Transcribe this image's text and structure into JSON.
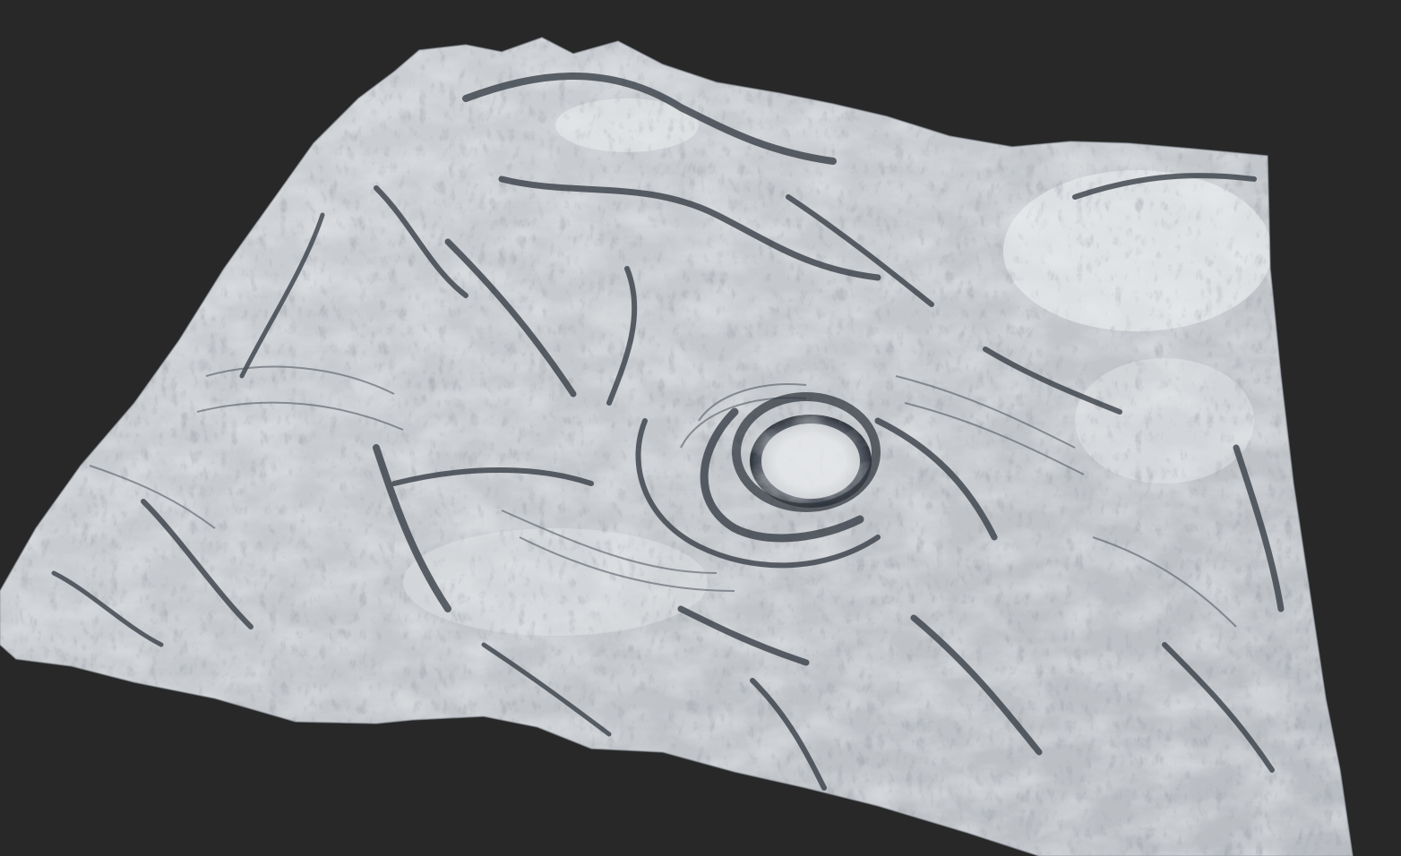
{
  "scene": {
    "background_color": "#282828",
    "terrain_base_color": "#c9ccd0",
    "terrain_highlight_color": "#e6e8ea",
    "terrain_shadow_color": "#353b44",
    "terrain_midtone_color": "#8a9099"
  }
}
